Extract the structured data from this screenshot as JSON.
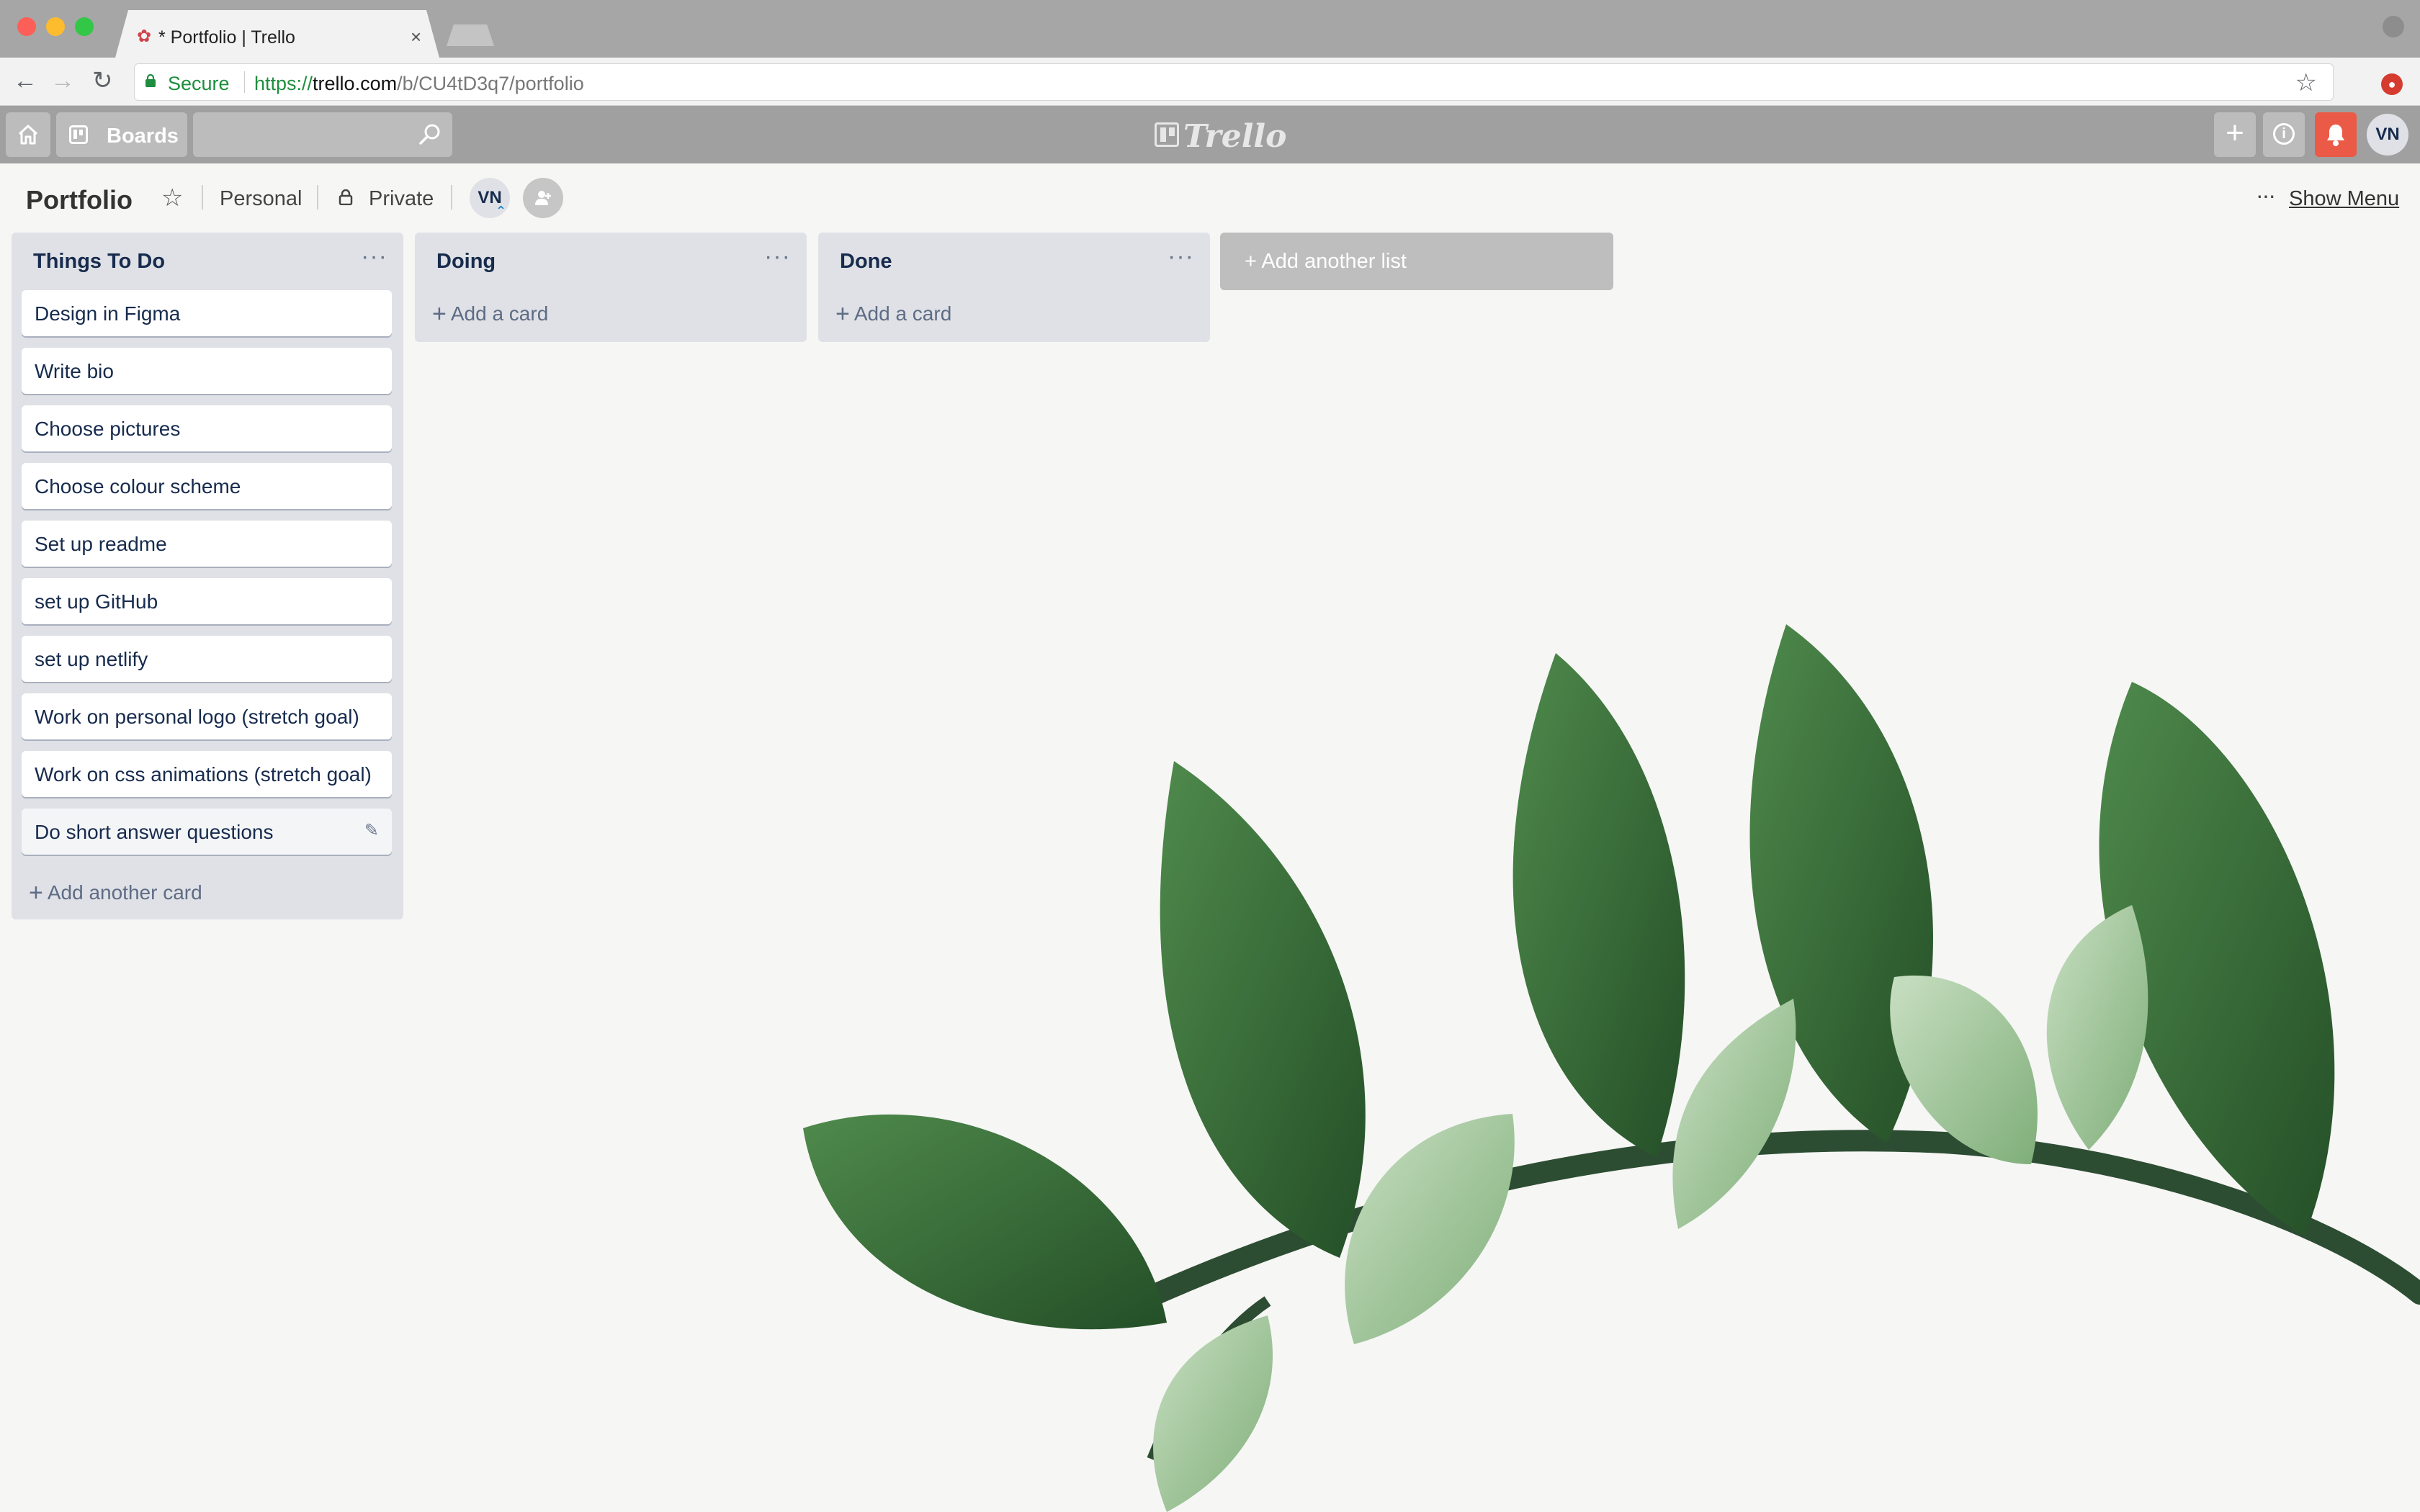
{
  "browser": {
    "tab_title": "* Portfolio | Trello",
    "secure_label": "Secure",
    "url_scheme": "https://",
    "url_host": "trello.com",
    "url_path": "/b/CU4tD3q7/portfolio"
  },
  "header": {
    "boards_label": "Boards",
    "search_placeholder": "",
    "logo_text": "Trello",
    "user_initials": "VN",
    "notification_color": "#eb5a46"
  },
  "board": {
    "title": "Portfolio",
    "team": "Personal",
    "visibility": "Private",
    "member_initials": "VN",
    "show_menu": "Show Menu",
    "add_list_label": "Add another list"
  },
  "lists": [
    {
      "title": "Things To Do",
      "cards": [
        "Design in Figma",
        "Write bio",
        "Choose pictures",
        "Choose colour scheme",
        "Set up readme",
        "set up GitHub",
        "set up netlify",
        "Work on personal logo (stretch goal)",
        "Work on css animations (stretch goal)",
        "Do short answer questions"
      ],
      "add_label": "Add another card"
    },
    {
      "title": "Doing",
      "cards": [],
      "add_label": "Add a card"
    },
    {
      "title": "Done",
      "cards": [],
      "add_label": "Add a card"
    }
  ],
  "icons": {
    "home": "home-icon",
    "boards": "boards-icon",
    "search": "search-icon",
    "add": "plus-icon",
    "info": "info-icon",
    "notifications": "bell-icon",
    "star": "star-icon",
    "lock": "lock-icon",
    "invite": "add-member-icon",
    "list_menu": "ellipsis-icon",
    "card_edit": "pencil-icon"
  }
}
